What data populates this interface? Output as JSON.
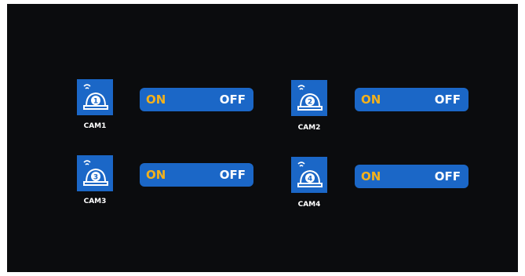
{
  "cameras": [
    {
      "label": "CAM1",
      "number": "1",
      "on_label": "ON",
      "off_label": "OFF"
    },
    {
      "label": "CAM2",
      "number": "2",
      "on_label": "ON",
      "off_label": "OFF"
    },
    {
      "label": "CAM3",
      "number": "3",
      "on_label": "ON",
      "off_label": "OFF"
    },
    {
      "label": "CAM4",
      "number": "4",
      "on_label": "ON",
      "off_label": "OFF"
    }
  ],
  "colors": {
    "screen_bg": "#0b0c0e",
    "tile_blue": "#1b67c7",
    "on_text": "#f3b11c",
    "off_text": "#ffffff"
  }
}
